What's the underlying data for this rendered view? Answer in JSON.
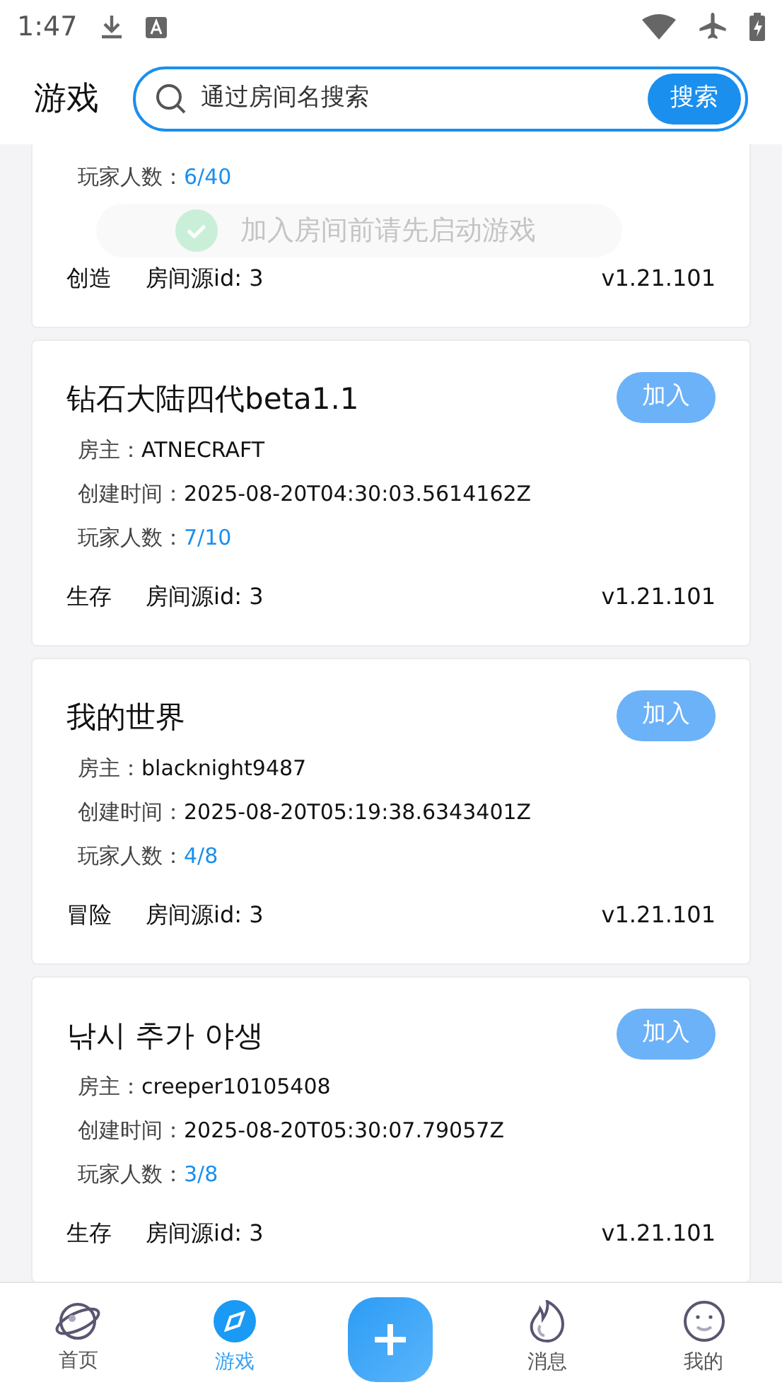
{
  "status_bar": {
    "time": "1:47"
  },
  "header": {
    "title": "游戏",
    "search": {
      "placeholder": "通过房间名搜索",
      "button": "搜索"
    }
  },
  "partial_room": {
    "players_label": "玩家人数：",
    "players": "6/40",
    "mode": "创造",
    "source": "房间源id: 3",
    "version": "v1.21.101"
  },
  "toast": {
    "text": "加入房间前请先启动游戏"
  },
  "rooms": [
    {
      "name": "钻石大陆四代beta1.1",
      "join": "加入",
      "owner_label": "房主：",
      "owner": "ATNECRAFT",
      "created_label": "创建时间：",
      "created": "2025-08-20T04:30:03.5614162Z",
      "players_label": "玩家人数：",
      "players": "7/10",
      "mode": "生存",
      "source": "房间源id: 3",
      "version": "v1.21.101"
    },
    {
      "name": "我的世界",
      "join": "加入",
      "owner_label": "房主：",
      "owner": "blacknight9487",
      "created_label": "创建时间：",
      "created": "2025-08-20T05:19:38.6343401Z",
      "players_label": "玩家人数：",
      "players": "4/8",
      "mode": "冒险",
      "source": "房间源id: 3",
      "version": "v1.21.101"
    },
    {
      "name": "낚시 추가 야생",
      "join": "加入",
      "owner_label": "房主：",
      "owner": "creeper10105408",
      "created_label": "创建时间：",
      "created": "2025-08-20T05:30:07.79057Z",
      "players_label": "玩家人数：",
      "players": "3/8",
      "mode": "生存",
      "source": "房间源id: 3",
      "version": "v1.21.101"
    }
  ],
  "bottom_nav": [
    {
      "kind": "planet",
      "label": "首页",
      "selected": false
    },
    {
      "kind": "compass",
      "label": "游戏",
      "selected": true
    },
    {
      "kind": "add",
      "selected": false
    },
    {
      "kind": "flame",
      "label": "消息",
      "selected": false
    },
    {
      "kind": "smile",
      "label": "我的",
      "selected": false
    }
  ]
}
